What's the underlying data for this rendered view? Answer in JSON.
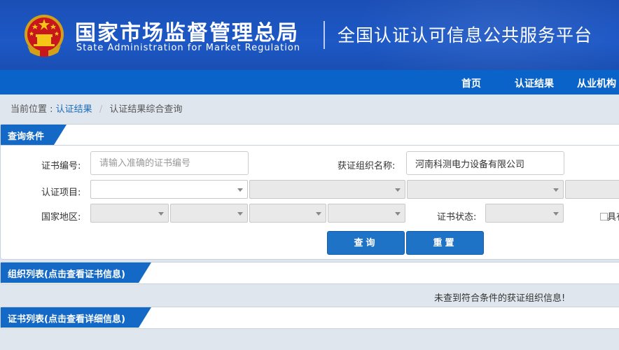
{
  "header": {
    "title_zh": "国家市场监督管理总局",
    "title_en": "State Administration  for  Market Regulation",
    "platform": "全国认证认可信息公共服务平台"
  },
  "nav": {
    "items": [
      "首页",
      "认证结果",
      "从业机构"
    ]
  },
  "breadcrumb": {
    "prefix": "当前位置 :",
    "link": "认证结果",
    "separator": "/",
    "current": "认证结果综合查询"
  },
  "query": {
    "tab": "查询条件",
    "cert_no_label": "证书编号:",
    "cert_no_placeholder": "请输入准确的证书编号",
    "org_name_label": "获证组织名称:",
    "org_name_value": "河南科测电力设备有限公司",
    "project_label": "认证项目:",
    "region_label": "国家地区:",
    "status_label": "证书状态:",
    "checkbox_label": "具有",
    "search_button": "查询",
    "reset_button": "重置"
  },
  "org_list": {
    "tab": "组织列表(点击查看证书信息)",
    "empty_message": "未查到符合条件的获证组织信息!"
  },
  "cert_list": {
    "tab": "证书列表(点击查看详细信息)"
  },
  "colors": {
    "header_blue": "#1b4fb6",
    "nav_blue": "#0a63c9",
    "tab_blue": "#1469c7",
    "button_blue": "#1f73c6",
    "link_blue": "#1c6bbd"
  }
}
